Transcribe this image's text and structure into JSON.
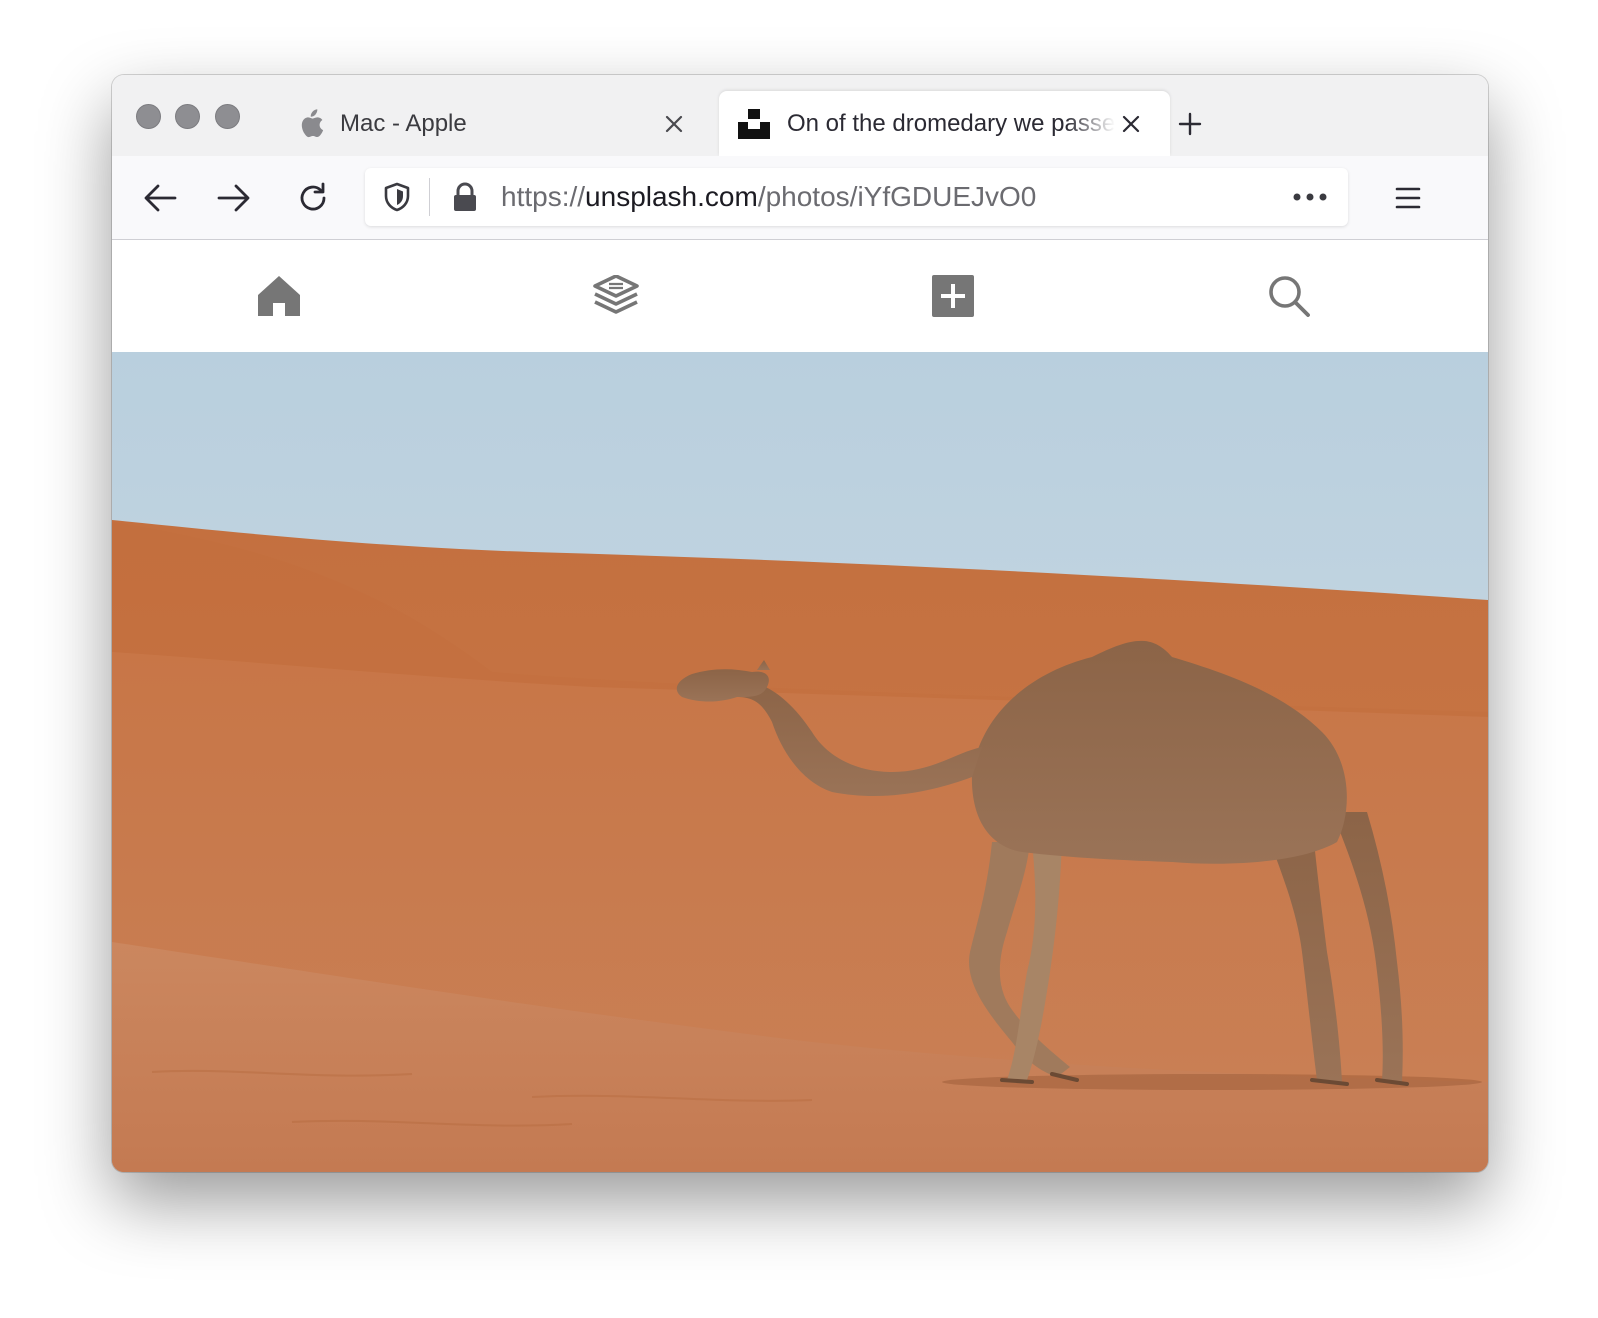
{
  "browser": {
    "tabs": [
      {
        "title": "Mac - Apple",
        "active": false,
        "icon": "apple-icon"
      },
      {
        "title": "On of the dromedary we passed",
        "active": true,
        "icon": "unsplash-icon"
      }
    ],
    "url": {
      "scheme": "https://",
      "host": "unsplash.com",
      "path": "/photos/iYfGDUEJvO0"
    },
    "icons": [
      "back-arrow-icon",
      "forward-arrow-icon",
      "reload-icon",
      "shield-icon",
      "lock-icon",
      "more-dots-icon",
      "hamburger-menu-icon",
      "new-tab-plus-icon",
      "close-icon"
    ]
  },
  "site": {
    "nav_icons": [
      "home-icon",
      "collections-layers-icon",
      "add-photo-icon",
      "search-icon"
    ],
    "icon_color": "#767676"
  },
  "photo": {
    "subject": "dromedary",
    "sky_color": "#c4d6e0",
    "sand_color": "#c87647"
  }
}
